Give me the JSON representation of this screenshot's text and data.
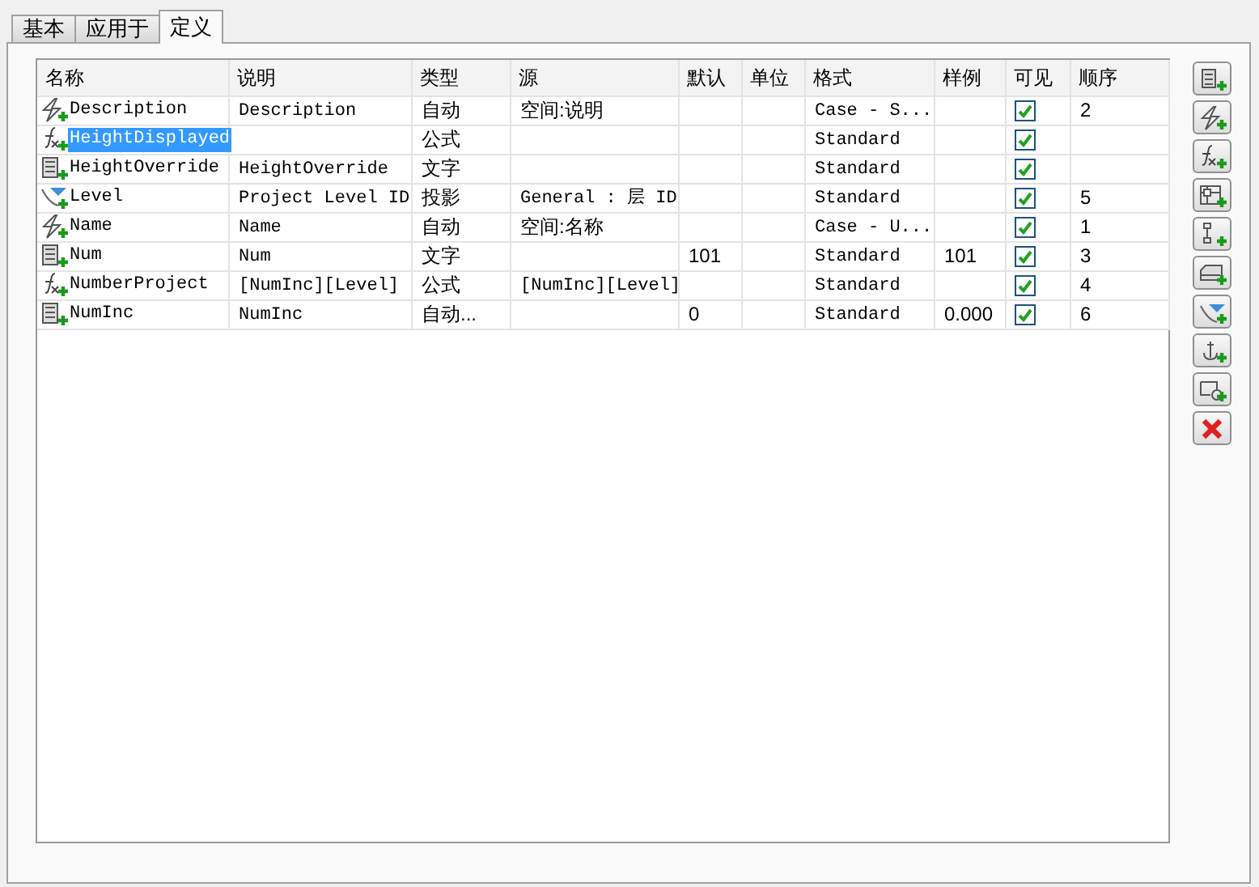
{
  "tabs": [
    {
      "label": "基本",
      "selected": false
    },
    {
      "label": "应用于",
      "selected": false
    },
    {
      "label": "定义",
      "selected": true
    }
  ],
  "table": {
    "columns": [
      "名称",
      "说明",
      "类型",
      "源",
      "默认",
      "单位",
      "格式",
      "样例",
      "可见",
      "顺序"
    ],
    "rows": [
      {
        "kind": "auto",
        "name": "Description",
        "selected": false,
        "description": "Description",
        "type": "自动",
        "source": "空间:说明",
        "default": "",
        "unit": "",
        "format": "Case - S...",
        "sample": "",
        "visible": true,
        "order": "2"
      },
      {
        "kind": "formula",
        "name": "HeightDisplayed",
        "selected": true,
        "description": "",
        "type": "公式",
        "source": "",
        "default": "",
        "unit": "",
        "format": "Standard",
        "sample": "",
        "visible": true,
        "order": ""
      },
      {
        "kind": "text",
        "name": "HeightOverride",
        "selected": false,
        "description": "HeightOverride",
        "type": "文字",
        "source": "",
        "default": "",
        "unit": "",
        "format": "Standard",
        "sample": "",
        "visible": true,
        "order": ""
      },
      {
        "kind": "projection",
        "name": "Level",
        "selected": false,
        "description": "Project Level ID",
        "type": "投影",
        "source": "General : 层 ID",
        "default": "",
        "unit": "",
        "format": "Standard",
        "sample": "",
        "visible": true,
        "order": "5"
      },
      {
        "kind": "auto",
        "name": "Name",
        "selected": false,
        "description": "Name",
        "type": "自动",
        "source": "空间:名称",
        "default": "",
        "unit": "",
        "format": "Case - U...",
        "sample": "",
        "visible": true,
        "order": "1"
      },
      {
        "kind": "text",
        "name": "Num",
        "selected": false,
        "description": "Num",
        "type": "文字",
        "source": "",
        "default": "101",
        "unit": "",
        "format": "Standard",
        "sample": "101",
        "visible": true,
        "order": "3"
      },
      {
        "kind": "formula",
        "name": "NumberProject",
        "selected": false,
        "description": "[NumInc][Level]",
        "type": "公式",
        "source": "[NumInc][Level]",
        "default": "",
        "unit": "",
        "format": "Standard",
        "sample": "",
        "visible": true,
        "order": "4"
      },
      {
        "kind": "text",
        "name": "NumInc",
        "selected": false,
        "description": "NumInc",
        "type": "自动...",
        "source": "",
        "default": "0",
        "unit": "",
        "format": "Standard",
        "sample": "0.000",
        "visible": true,
        "order": "6"
      }
    ]
  }
}
